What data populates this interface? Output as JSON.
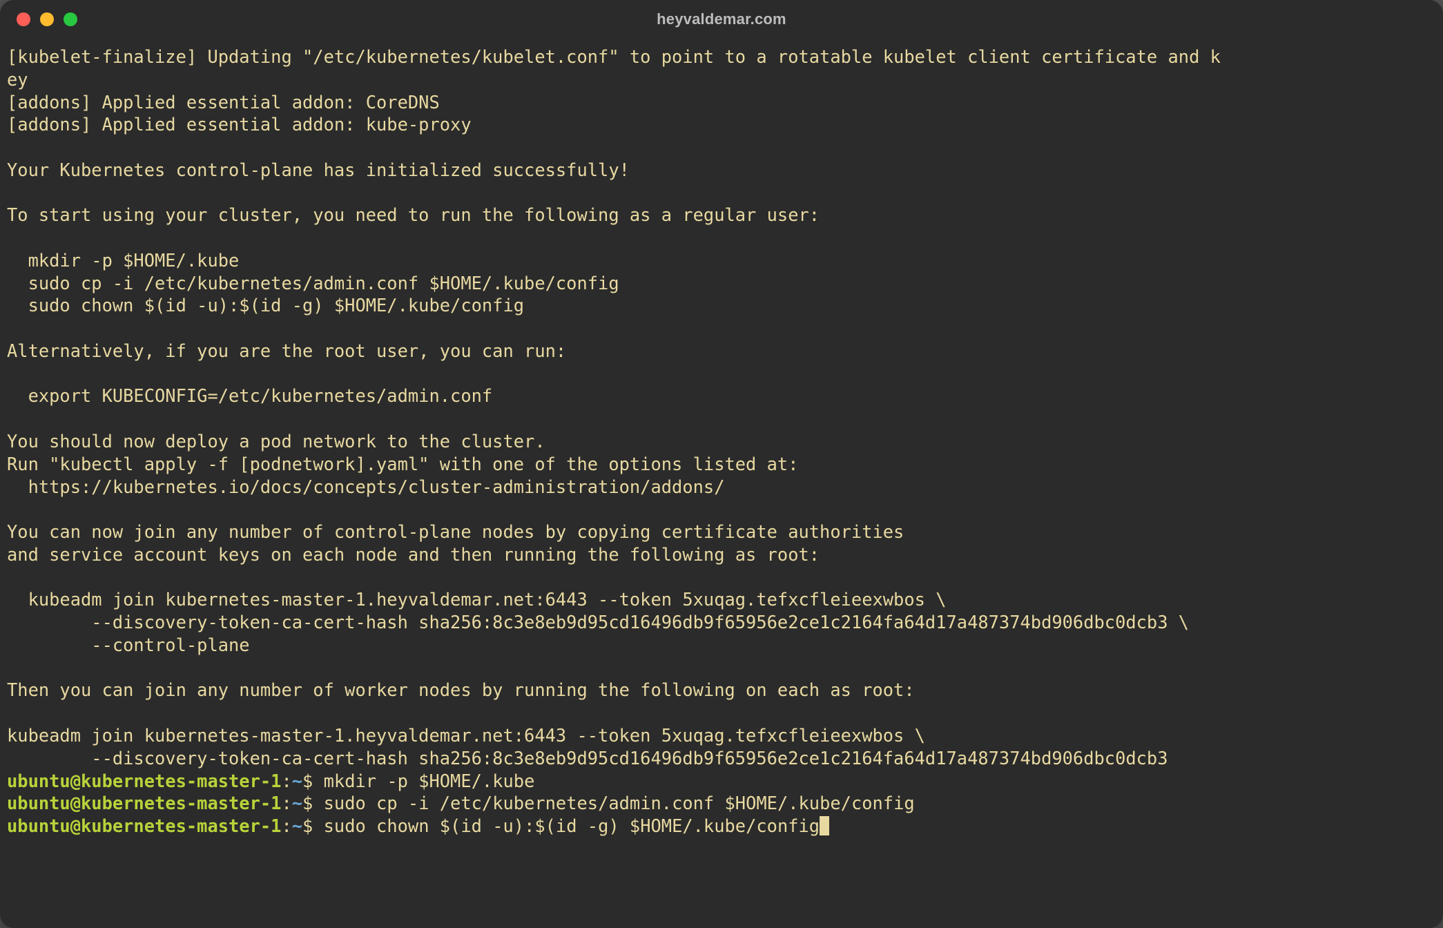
{
  "window": {
    "title": "heyvaldemar.com"
  },
  "output": {
    "l01": "[kubelet-finalize] Updating \"/etc/kubernetes/kubelet.conf\" to point to a rotatable kubelet client certificate and k",
    "l02": "ey",
    "l03": "[addons] Applied essential addon: CoreDNS",
    "l04": "[addons] Applied essential addon: kube-proxy",
    "l05": "",
    "l06": "Your Kubernetes control-plane has initialized successfully!",
    "l07": "",
    "l08": "To start using your cluster, you need to run the following as a regular user:",
    "l09": "",
    "l10": "  mkdir -p $HOME/.kube",
    "l11": "  sudo cp -i /etc/kubernetes/admin.conf $HOME/.kube/config",
    "l12": "  sudo chown $(id -u):$(id -g) $HOME/.kube/config",
    "l13": "",
    "l14": "Alternatively, if you are the root user, you can run:",
    "l15": "",
    "l16": "  export KUBECONFIG=/etc/kubernetes/admin.conf",
    "l17": "",
    "l18": "You should now deploy a pod network to the cluster.",
    "l19": "Run \"kubectl apply -f [podnetwork].yaml\" with one of the options listed at:",
    "l20": "  https://kubernetes.io/docs/concepts/cluster-administration/addons/",
    "l21": "",
    "l22": "You can now join any number of control-plane nodes by copying certificate authorities",
    "l23": "and service account keys on each node and then running the following as root:",
    "l24": "",
    "l25": "  kubeadm join kubernetes-master-1.heyvaldemar.net:6443 --token 5xuqag.tefxcfleieexwbos \\",
    "l26": "        --discovery-token-ca-cert-hash sha256:8c3e8eb9d95cd16496db9f65956e2ce1c2164fa64d17a487374bd906dbc0dcb3 \\",
    "l27": "        --control-plane ",
    "l28": "",
    "l29": "Then you can join any number of worker nodes by running the following on each as root:",
    "l30": "",
    "l31": "kubeadm join kubernetes-master-1.heyvaldemar.net:6443 --token 5xuqag.tefxcfleieexwbos \\",
    "l32": "        --discovery-token-ca-cert-hash sha256:8c3e8eb9d95cd16496db9f65956e2ce1c2164fa64d17a487374bd906dbc0dcb3 "
  },
  "prompts": [
    {
      "user": "ubuntu@kubernetes-master-1",
      "sep1": ":",
      "path": "~",
      "sep2": "$ ",
      "cmd": "mkdir -p $HOME/.kube",
      "cursor": false
    },
    {
      "user": "ubuntu@kubernetes-master-1",
      "sep1": ":",
      "path": "~",
      "sep2": "$ ",
      "cmd": "sudo cp -i /etc/kubernetes/admin.conf $HOME/.kube/config",
      "cursor": false
    },
    {
      "user": "ubuntu@kubernetes-master-1",
      "sep1": ":",
      "path": "~",
      "sep2": "$ ",
      "cmd": "sudo chown $(id -u):$(id -g) $HOME/.kube/config",
      "cursor": true
    }
  ],
  "colors": {
    "bg": "#2b2b2b",
    "text": "#e8d9a1",
    "prompt_user": "#b8d33a",
    "prompt_path": "#6aa7d6"
  }
}
